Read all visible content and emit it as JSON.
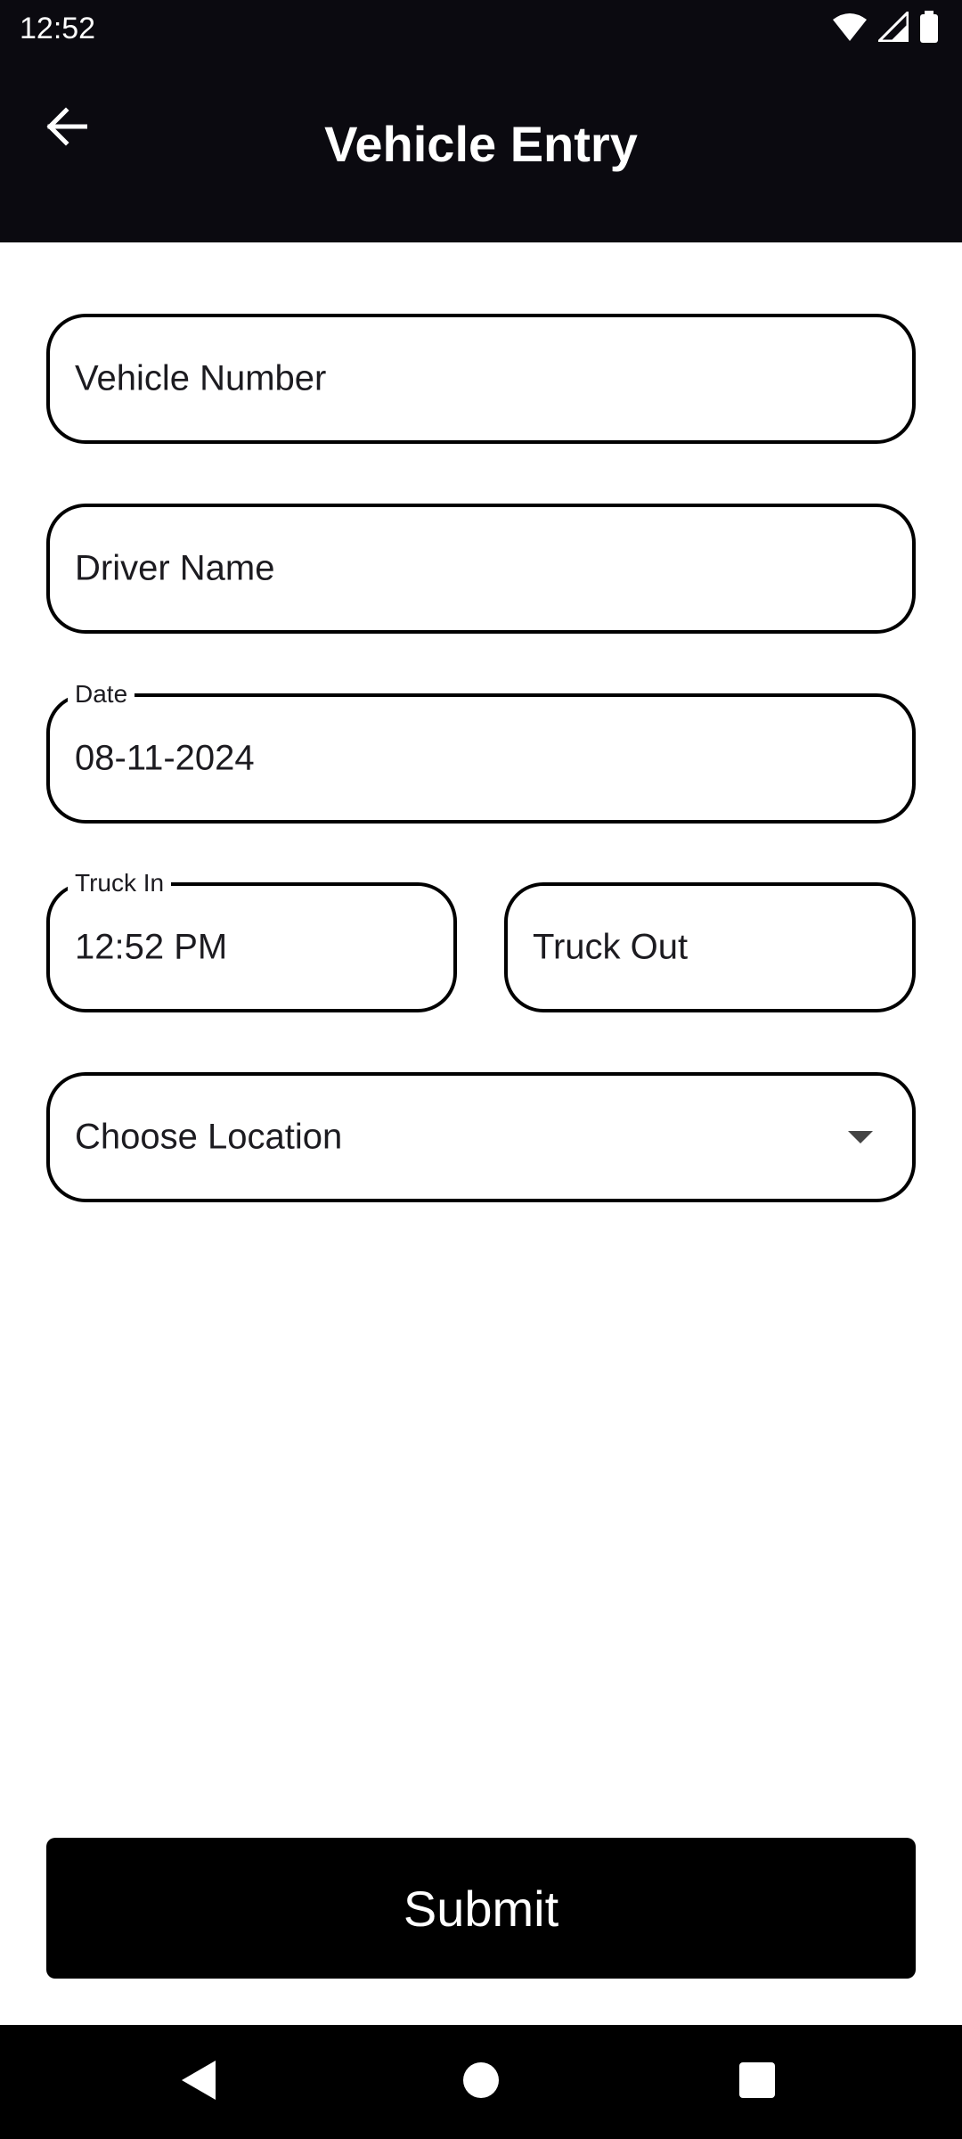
{
  "status_bar": {
    "time": "12:52",
    "icons": [
      "wifi-icon",
      "signal-icon",
      "battery-icon"
    ]
  },
  "app_bar": {
    "title": "Vehicle Entry",
    "back_icon": "arrow-left-icon"
  },
  "form": {
    "vehicle_number": {
      "placeholder": "Vehicle Number",
      "value": ""
    },
    "driver_name": {
      "placeholder": "Driver Name",
      "value": ""
    },
    "date": {
      "label": "Date",
      "value": "08-11-2024"
    },
    "truck_in": {
      "label": "Truck In",
      "value": "12:52 PM"
    },
    "truck_out": {
      "placeholder": "Truck Out",
      "value": ""
    },
    "location": {
      "placeholder": "Choose Location",
      "value": ""
    }
  },
  "submit_label": "Submit",
  "colors": {
    "app_bar_bg": "#0b0a10",
    "field_border": "#000000",
    "button_bg": "#000000",
    "button_text": "#ffffff"
  }
}
